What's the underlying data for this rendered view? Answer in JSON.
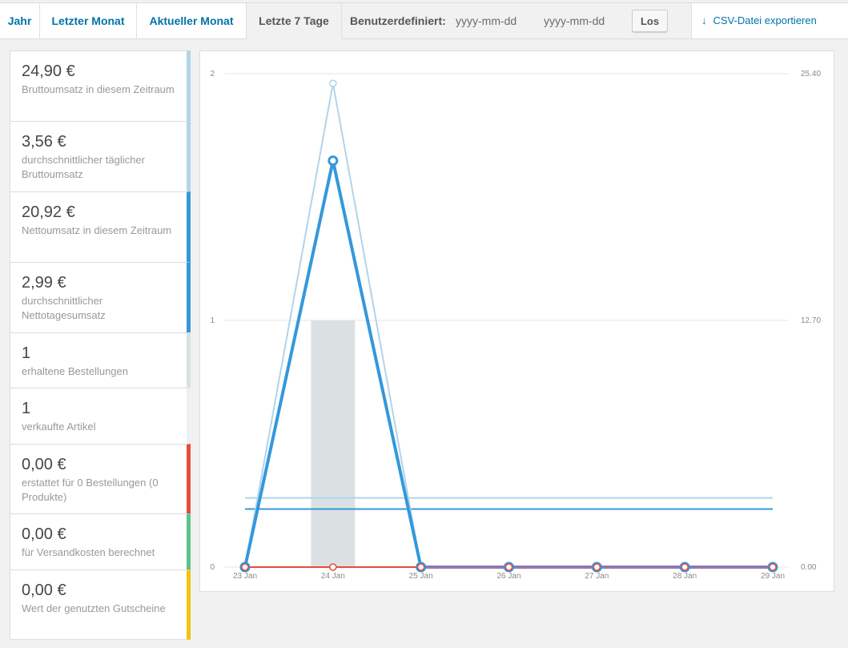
{
  "tabs": [
    {
      "label": "Jahr"
    },
    {
      "label": "Letzter Monat"
    },
    {
      "label": "Aktueller Monat"
    },
    {
      "label": "Letzte 7 Tage"
    }
  ],
  "custom_range": {
    "label": "Benutzerdefiniert:",
    "start_placeholder": "yyyy-mm-dd",
    "end_placeholder": "yyyy-mm-dd",
    "go_label": "Los"
  },
  "export": {
    "label": "CSV-Datei exportieren",
    "icon": "download-arrow-icon"
  },
  "legend": [
    {
      "value": "24,90 €",
      "desc": "Bruttoumsatz in diesem Zeitraum",
      "color": "#b1d4ea"
    },
    {
      "value": "3,56 €",
      "desc": "durchschnittlicher täglicher Bruttoumsatz",
      "color": "#b1d4ea"
    },
    {
      "value": "20,92 €",
      "desc": "Nettoumsatz in diesem Zeitraum",
      "color": "#3498db"
    },
    {
      "value": "2,99 €",
      "desc": "durchschnittlicher Nettotagesumsatz",
      "color": "#3498db"
    },
    {
      "value": "1",
      "desc": "erhaltene Bestellungen",
      "color": "#dbe1e3"
    },
    {
      "value": "1",
      "desc": "verkaufte Artikel",
      "color": "#ecf0f1"
    },
    {
      "value": "0,00 €",
      "desc": "erstattet für 0 Bestellungen (0 Produkte)",
      "color": "#e74c3c"
    },
    {
      "value": "0,00 €",
      "desc": "für Versandkosten berechnet",
      "color": "#5cc488"
    },
    {
      "value": "0,00 €",
      "desc": "Wert der genutzten Gutscheine",
      "color": "#f1c40f"
    }
  ],
  "chart_data": {
    "type": "bar",
    "categories": [
      "23 Jan",
      "24 Jan",
      "25 Jan",
      "26 Jan",
      "27 Jan",
      "28 Jan",
      "29 Jan"
    ],
    "y_left": {
      "ticks": [
        "0",
        "1",
        "2"
      ],
      "range": [
        0,
        2
      ]
    },
    "y_right": {
      "ticks": [
        "0.00",
        "12.70",
        "25.40"
      ],
      "range": [
        0,
        25.4
      ]
    },
    "series": [
      {
        "kind": "bar",
        "axis": "left",
        "color": "#dbe1e3",
        "values": [
          0,
          1,
          0,
          0,
          0,
          0,
          0
        ]
      },
      {
        "kind": "line",
        "axis": "right",
        "color": "#b1d4ea",
        "values": [
          0,
          24.9,
          0,
          0,
          0,
          0,
          0
        ]
      },
      {
        "kind": "line",
        "axis": "right",
        "color": "#3498db",
        "values": [
          0,
          20.92,
          0,
          0,
          0,
          0,
          0
        ]
      },
      {
        "kind": "line",
        "axis": "right",
        "color": "#e74c3c",
        "values": [
          0,
          0,
          0,
          0,
          0,
          0,
          0
        ]
      },
      {
        "kind": "line",
        "axis": "right",
        "color": "#8e7bae",
        "values": [
          null,
          null,
          0,
          0,
          0,
          0,
          0
        ]
      },
      {
        "kind": "hline",
        "axis": "right",
        "color": "#b1d4ea",
        "value": 3.56
      },
      {
        "kind": "hline",
        "axis": "right",
        "color": "#3498db",
        "value": 2.99
      }
    ],
    "grid": true
  }
}
